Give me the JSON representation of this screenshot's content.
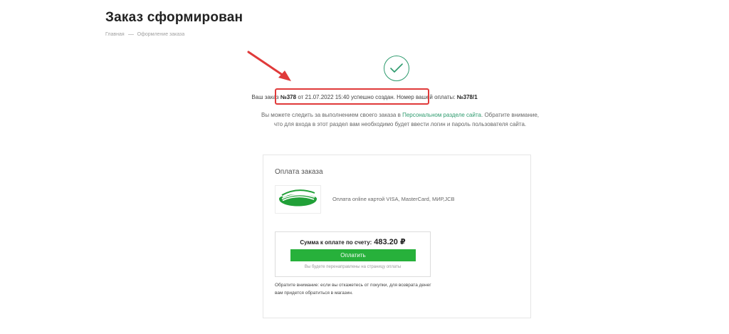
{
  "page": {
    "title": "Заказ сформирован"
  },
  "breadcrumb": {
    "home": "Главная",
    "current": "Оформление заказа"
  },
  "order": {
    "prefix": "Ваш заказ",
    "number": "№378",
    "date_text": "от 21.07.2022 15:40 успешно создан.",
    "payment_label": "Номер вашей оплаты:",
    "payment_number": "№378/1"
  },
  "info": {
    "text_before": "Вы можете следить за выполнением своего заказа в",
    "link": "Персональном разделе сайта",
    "text_after": ". Обратите внимание, что для входа в этот раздел вам необходимо будет ввести логин и пароль пользователя сайта."
  },
  "payment": {
    "title": "Оплата заказа",
    "method": "Оплата online картой VISA, MasterCard, МИР,JCB",
    "sum_label": "Сумма к оплате по счету:",
    "amount": "483.20 ₽",
    "button": "Оплатить",
    "redirect_note": "Вы будете перенаправлены на страницу оплаты",
    "notice": "Обратите внимание: если вы откажетесь от покупки, для возврата денег вам придется обратиться в магазин."
  },
  "colors": {
    "accent_green": "#2e9b6e",
    "button_green": "#27b13b",
    "highlight_red": "#e03a3a"
  }
}
